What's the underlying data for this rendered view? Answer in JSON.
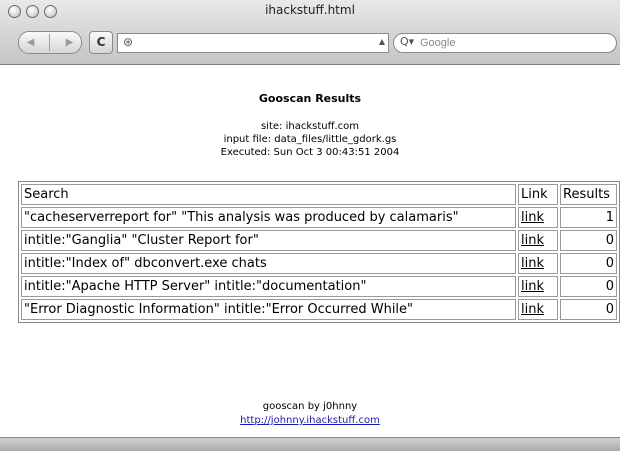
{
  "window": {
    "title": "ihackstuff.html"
  },
  "toolbar": {
    "back_icon": "back-arrow",
    "forward_icon": "forward-arrow",
    "reload_label": "C",
    "url_value": "",
    "search_placeholder": "Google"
  },
  "page": {
    "title": "Gooscan Results",
    "site": "site: ihackstuff.com",
    "input_file": "input file: data_files/little_gdork.gs",
    "executed": "Executed: Sun Oct 3 00:43:51 2004"
  },
  "table": {
    "headers": {
      "search": "Search",
      "link": "Link",
      "results": "Results"
    },
    "rows": [
      {
        "search": "\"cacheserverreport for\" \"This analysis was produced by calamaris\"",
        "link": "link",
        "results": "1"
      },
      {
        "search": "intitle:\"Ganglia\" \"Cluster Report for\"",
        "link": "link",
        "results": "0"
      },
      {
        "search": "intitle:\"Index of\" dbconvert.exe chats",
        "link": "link",
        "results": "0"
      },
      {
        "search": "intitle:\"Apache HTTP Server\" intitle:\"documentation\"",
        "link": "link",
        "results": "0"
      },
      {
        "search": "\"Error Diagnostic Information\" intitle:\"Error Occurred While\"",
        "link": "link",
        "results": "0"
      }
    ]
  },
  "footer": {
    "credit": "gooscan by j0hnny",
    "url": "http://johnny.ihackstuff.com"
  }
}
